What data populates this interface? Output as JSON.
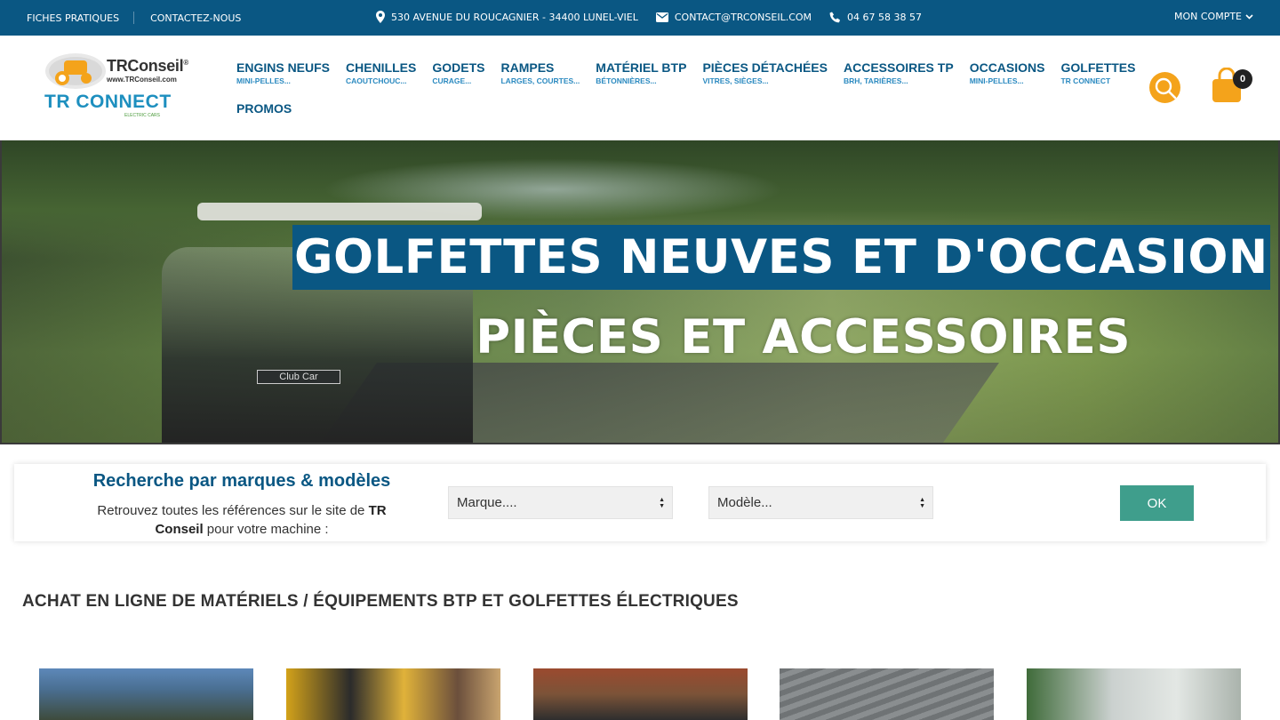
{
  "topbar": {
    "left_links": [
      "FICHES PRATIQUES",
      "CONTACTEZ-NOUS"
    ],
    "address": "530 AVENUE DU ROUCAGNIER - 34400 LUNEL-VIEL",
    "email": "CONTACT@TRCONSEIL.COM",
    "phone": "04 67 58 38 57",
    "account": "MON COMPTE"
  },
  "logo": {
    "brand": "TRConseil",
    "registered": "®",
    "url": "www.TRConseil.com",
    "sub_brand": "TR CONNECT",
    "sub_tagline": "ELECTRIC CARS"
  },
  "nav": {
    "items": [
      {
        "title": "ENGINS NEUFS",
        "sub": "MINI-PELLES..."
      },
      {
        "title": "CHENILLES",
        "sub": "CAOUTCHOUC..."
      },
      {
        "title": "GODETS",
        "sub": "CURAGE..."
      },
      {
        "title": "RAMPES",
        "sub": "LARGES, COURTES..."
      },
      {
        "title": "MATÉRIEL BTP",
        "sub": "BÉTONNIÈRES..."
      },
      {
        "title": "PIÈCES DÉTACHÉES",
        "sub": "VITRES, SIÈGES..."
      },
      {
        "title": "ACCESSOIRES TP",
        "sub": "BRH, TARIÈRES..."
      },
      {
        "title": "OCCASIONS",
        "sub": "MINI-PELLES..."
      },
      {
        "title": "GOLFETTES",
        "sub": "TR CONNECT"
      }
    ],
    "promo": "PROMOS"
  },
  "cart": {
    "count": "0"
  },
  "hero": {
    "title": "GOLFETTES NEUVES ET D'OCCASION",
    "subtitle": "PIÈCES ET ACCESSOIRES",
    "cart_badge_text": "Club Car"
  },
  "finder": {
    "title": "Recherche par marques & modèles",
    "desc_before": "Retrouvez toutes les références sur le site de ",
    "desc_bold": "TR Conseil",
    "desc_after": " pour votre machine :",
    "brand_select": "Marque....",
    "model_select": "Modèle...",
    "ok": "OK"
  },
  "section": {
    "title": "ACHAT EN LIGNE DE MATÉRIELS / ÉQUIPEMENTS BTP ET GOLFETTES ÉLECTRIQUES"
  },
  "colors": {
    "primary": "#0a5783",
    "accent": "#f4a31b",
    "ok_button": "#3f9e8c"
  }
}
